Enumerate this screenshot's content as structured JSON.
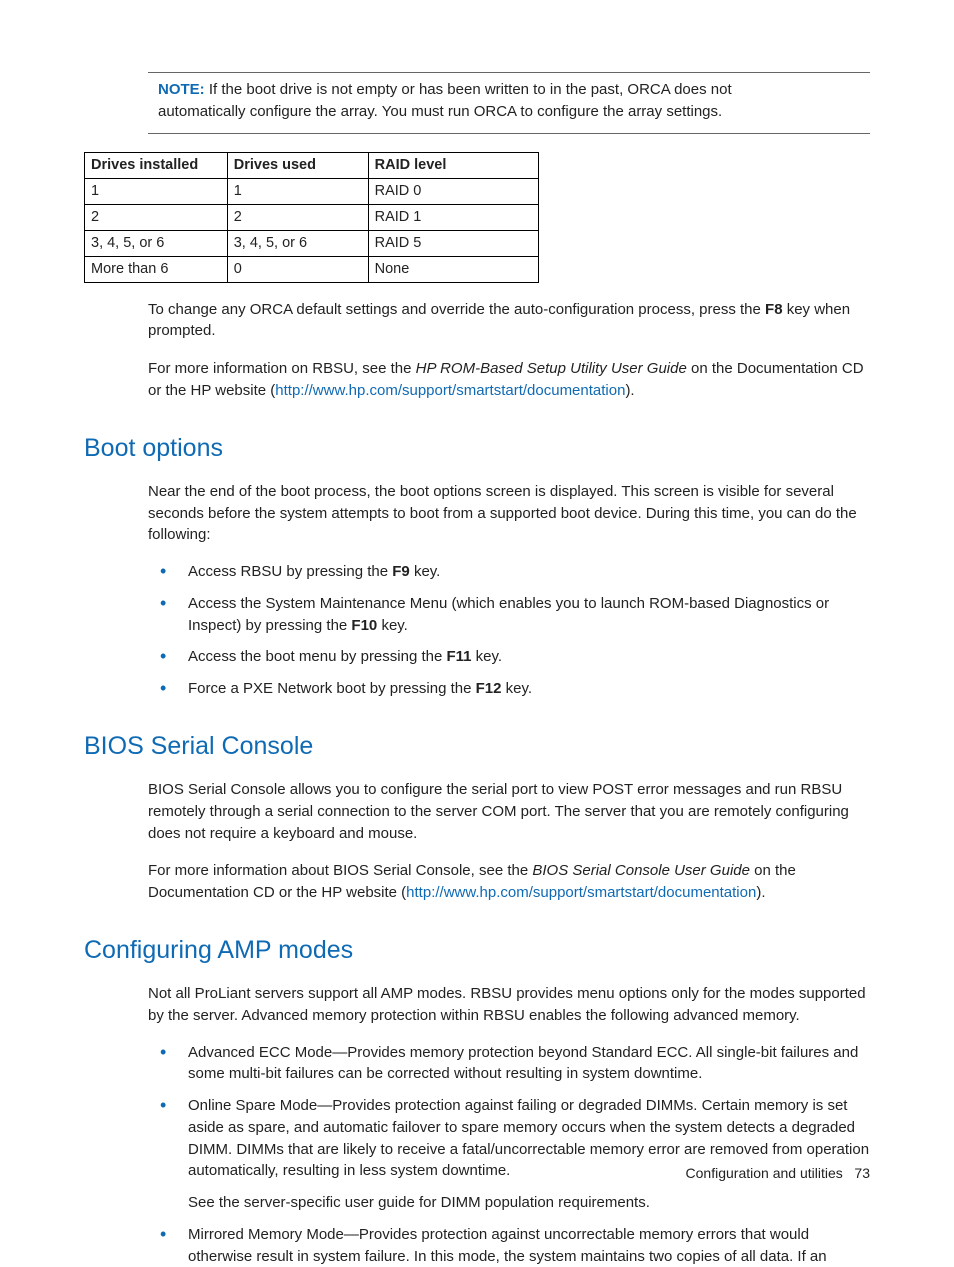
{
  "note": {
    "label": "NOTE:",
    "text_a": "  If the boot drive is not empty or has been written to in the past, ORCA does not automatically configure the array. You must run ORCA to configure the array settings."
  },
  "table": {
    "headers": [
      "Drives installed",
      "Drives used",
      "RAID level"
    ],
    "rows": [
      [
        "1",
        "1",
        "RAID 0"
      ],
      [
        "2",
        "2",
        "RAID 1"
      ],
      [
        "3, 4, 5, or 6",
        "3, 4, 5, or 6",
        "RAID 5"
      ],
      [
        "More than 6",
        "0",
        "None"
      ]
    ]
  },
  "orca_para_a": "To change any ORCA default settings and override the auto-configuration process, press the ",
  "orca_key": "F8",
  "orca_para_b": " key when prompted.",
  "rbsu_para_a": "For more information on RBSU, see the ",
  "rbsu_em": "HP ROM-Based Setup Utility User Guide",
  "rbsu_para_b": " on the Documentation CD or the HP website (",
  "rbsu_link": "http://www.hp.com/support/smartstart/documentation",
  "rbsu_para_c": ").",
  "boot": {
    "heading": "Boot options",
    "intro": "Near the end of the boot process, the boot options screen is displayed. This screen is visible for several seconds before the system attempts to boot from a supported boot device. During this time, you can do the following:",
    "items": [
      {
        "pre": "Access RBSU by pressing the ",
        "key": "F9",
        "post": " key."
      },
      {
        "pre": "Access the System Maintenance Menu (which enables you to launch ROM-based Diagnostics or Inspect) by pressing the ",
        "key": "F10",
        "post": " key."
      },
      {
        "pre": "Access the boot menu by pressing the ",
        "key": "F11",
        "post": " key."
      },
      {
        "pre": "Force a PXE Network boot by pressing the ",
        "key": "F12",
        "post": " key."
      }
    ]
  },
  "bios": {
    "heading": "BIOS Serial Console",
    "p1": "BIOS Serial Console allows you to configure the serial port to view POST error messages and run RBSU remotely through a serial connection to the server COM port. The server that you are remotely configuring does not require a keyboard and mouse.",
    "p2a": "For more information about BIOS Serial Console, see the ",
    "p2em": "BIOS Serial Console User Guide",
    "p2b": " on the Documentation CD or the HP website (",
    "p2link": "http://www.hp.com/support/smartstart/documentation",
    "p2c": ")."
  },
  "amp": {
    "heading": "Configuring AMP modes",
    "intro": "Not all ProLiant servers support all AMP modes. RBSU provides menu options only for the modes supported by the server. Advanced memory protection within RBSU enables the following advanced memory.",
    "items": [
      "Advanced ECC Mode—Provides memory protection beyond Standard ECC. All single-bit failures and some multi-bit failures can be corrected without resulting in system downtime.",
      "Online Spare Mode—Provides protection against failing or degraded DIMMs. Certain memory is set aside as spare, and automatic failover to spare memory occurs when the system detects a degraded DIMM. DIMMs that are likely to receive a fatal/uncorrectable memory error are removed from operation automatically, resulting in less system downtime.",
      "Mirrored Memory Mode—Provides protection against uncorrectable memory errors that would otherwise result in system failure. In this mode, the system maintains two copies of all data. If an"
    ],
    "spare_sub": "See the server-specific user guide for DIMM population requirements."
  },
  "footer": {
    "section": "Configuration and utilities",
    "page": "73"
  }
}
